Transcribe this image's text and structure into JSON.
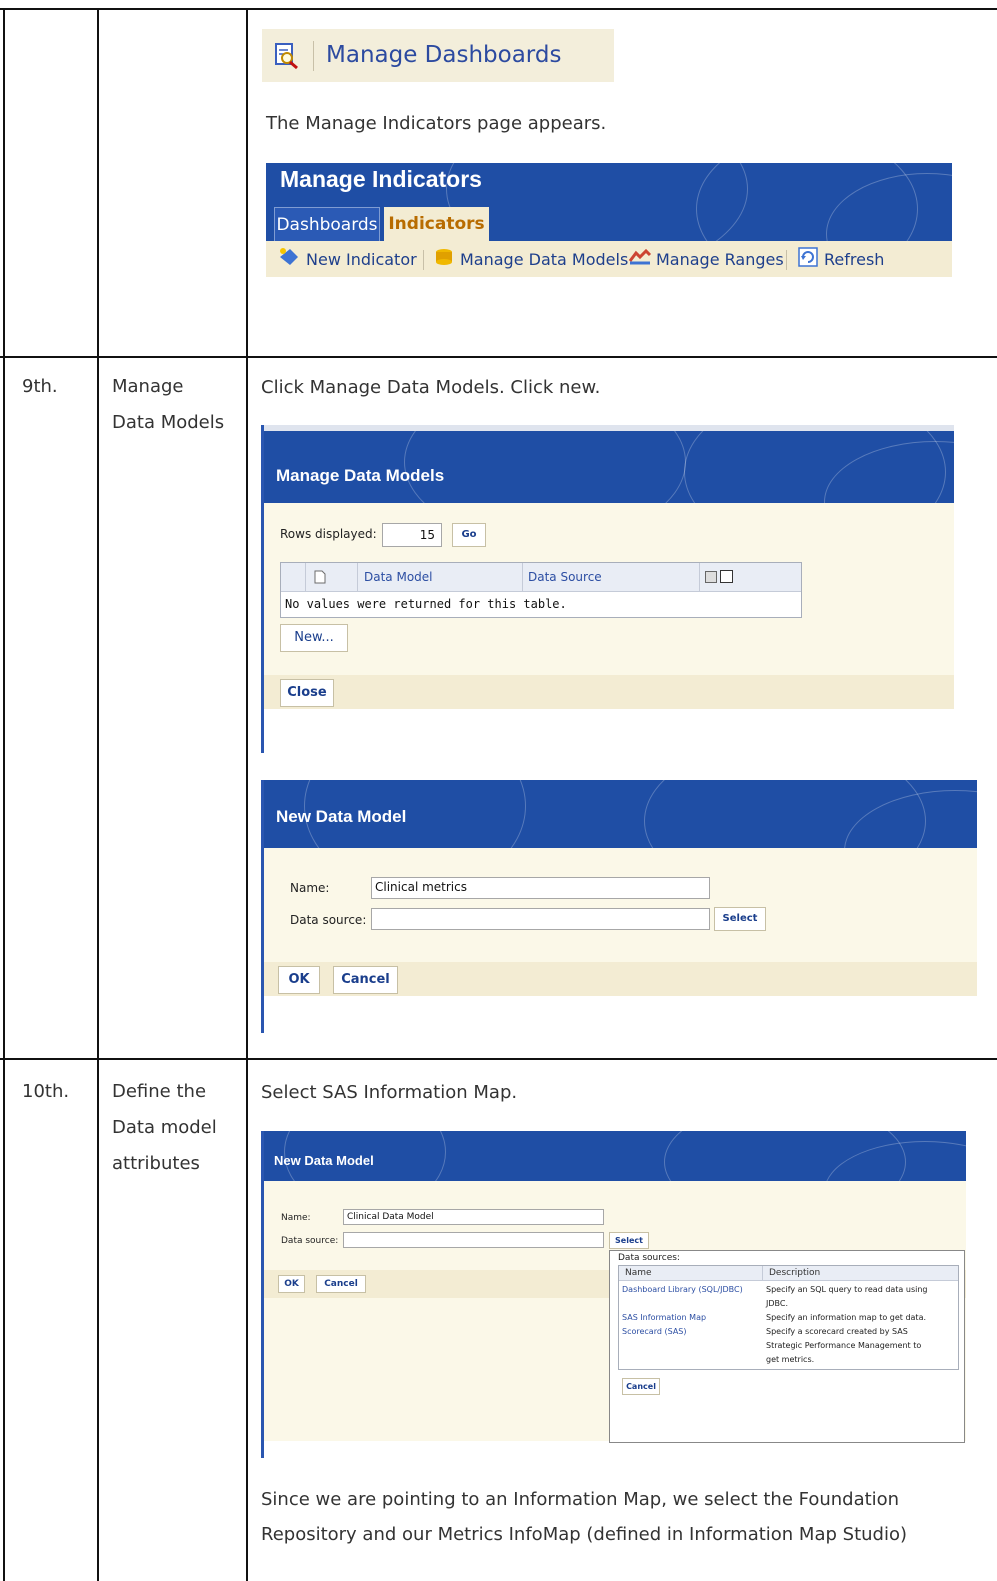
{
  "rows": [
    {
      "step": "",
      "title": "",
      "intro_button": "Manage Dashboards",
      "text": "The Manage Indicators page appears.",
      "screenshot": {
        "title": "Manage Indicators",
        "tabs": [
          "Dashboards",
          "Indicators"
        ],
        "toolbar": [
          "New Indicator",
          "Manage Data Models",
          "Manage Ranges",
          "Refresh"
        ]
      }
    },
    {
      "step": "9th.",
      "title_lines": [
        "Manage",
        "Data Models"
      ],
      "text": "Click Manage Data Models. Click new.",
      "models_dialog": {
        "title": "Manage Data Models",
        "rows_label": "Rows displayed:",
        "rows_value": "15",
        "go": "Go",
        "columns": [
          "Data Model",
          "Data Source"
        ],
        "empty": "No values were returned for this table.",
        "new_button": "New...",
        "close_button": "Close"
      },
      "new_dialog": {
        "title": "New Data Model",
        "name_label": "Name:",
        "name_value": "Clinical metrics",
        "source_label": "Data source:",
        "select": "Select",
        "ok": "OK",
        "cancel": "Cancel"
      }
    },
    {
      "step": "10th.",
      "title_lines": [
        "Define the",
        "Data model",
        "attributes"
      ],
      "text": "Select SAS Information Map.",
      "dialog": {
        "title": "New Data Model",
        "name_label": "Name:",
        "name_value": "Clinical Data Model",
        "source_label": "Data source:",
        "select": "Select",
        "ok": "OK",
        "cancel": "Cancel",
        "popup_title": "Data sources:",
        "popup_columns": [
          "Name",
          "Description"
        ],
        "popup_names": [
          "Dashboard Library (SQL/JDBC)",
          "SAS Information Map",
          "Scorecard (SAS)"
        ],
        "popup_descriptions": [
          "Specify an SQL query to read data using",
          "JDBC.",
          "Specify an information map to get data.",
          "Specify a scorecard created by SAS",
          "Strategic Performance Management to",
          "get metrics."
        ],
        "popup_cancel": "Cancel"
      },
      "text2_lines": [
        "Since we are pointing to an Information Map, we select the Foundation",
        "Repository and our Metrics InfoMap (defined in Information Map Studio)"
      ]
    }
  ]
}
